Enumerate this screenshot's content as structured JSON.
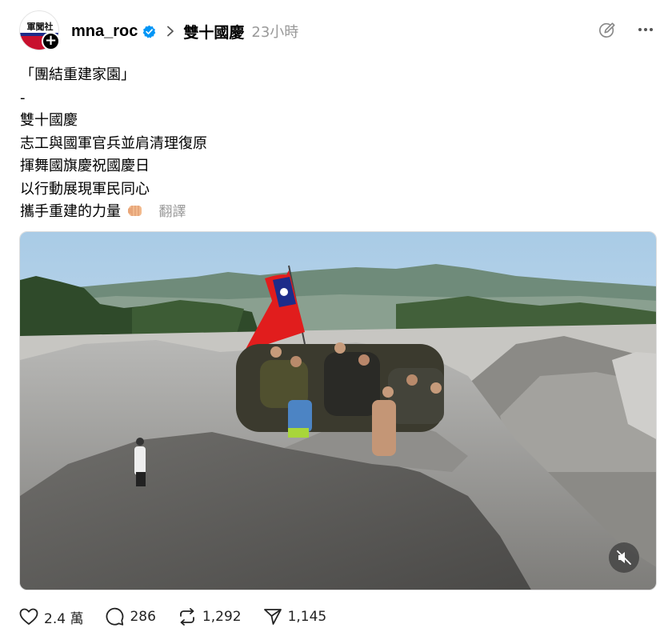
{
  "post": {
    "username": "mna_roc",
    "avatar_text": "軍聞社",
    "topic": "雙十國慶",
    "time": "23小時",
    "lines": [
      "「團結重建家園」",
      "-",
      "雙十國慶",
      "志工與國軍官兵並肩清理復原",
      "揮舞國旗慶祝國慶日",
      "以行動展現軍民同心",
      "攜手重建的力量"
    ],
    "emoji": "fist-bump-emoji",
    "translate_label": "翻譯"
  },
  "actions": {
    "likes": "2.4 萬",
    "comments": "286",
    "reposts": "1,292",
    "shares": "1,145"
  },
  "icons": [
    "verified-icon",
    "chevron-right-icon",
    "edit-icon",
    "more-icon",
    "mute-icon",
    "heart-icon",
    "comment-icon",
    "repost-icon",
    "share-icon"
  ],
  "colors": {
    "verified": "#0095f6",
    "flag_red": "#e11d1d",
    "flag_blue": "#1d2c8a",
    "muted_text": "#999999"
  }
}
